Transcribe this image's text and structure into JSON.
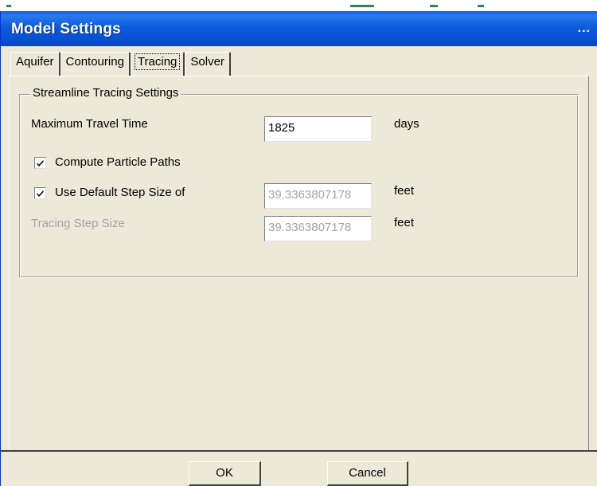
{
  "window": {
    "title": "Model Settings",
    "title_overflow": "..."
  },
  "tabs": [
    {
      "label": "Aquifer",
      "active": false
    },
    {
      "label": "Contouring",
      "active": false
    },
    {
      "label": "Tracing",
      "active": true
    },
    {
      "label": "Solver",
      "active": false
    }
  ],
  "group": {
    "title": "Streamline Tracing Settings",
    "max_travel_time": {
      "label": "Maximum Travel Time",
      "value": "1825",
      "unit": "days"
    },
    "compute_particle_paths": {
      "label": "Compute Particle Paths",
      "checked": true
    },
    "use_default_step": {
      "label": "Use Default Step Size of",
      "checked": true,
      "value": "39.3363807178",
      "unit": "feet"
    },
    "tracing_step_size": {
      "label": "Tracing Step Size",
      "value": "39.3363807178",
      "unit": "feet",
      "disabled": true
    }
  },
  "buttons": {
    "ok": "OK",
    "cancel": "Cancel"
  },
  "colors": {
    "titlebar": "#0b5cdb",
    "dialog_face": "#ece9d8",
    "disabled_text": "#a3a3a3"
  }
}
